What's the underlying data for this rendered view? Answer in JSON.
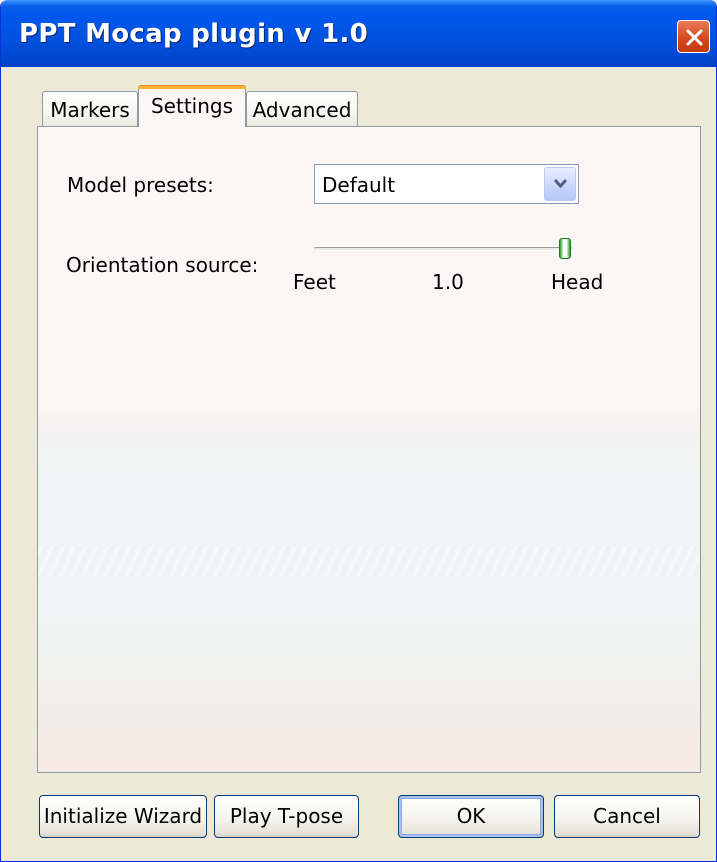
{
  "window": {
    "title": "PPT Mocap plugin v 1.0"
  },
  "tabs": [
    {
      "label": "Markers",
      "active": false
    },
    {
      "label": "Settings",
      "active": true
    },
    {
      "label": "Advanced",
      "active": false
    }
  ],
  "settings": {
    "model_presets": {
      "label": "Model presets:",
      "value": "Default"
    },
    "orientation_source": {
      "label": "Orientation source:",
      "min_label": "Feet",
      "value_label": "1.0",
      "max_label": "Head",
      "value": 1.0
    }
  },
  "buttons": {
    "initialize_wizard": "Initialize Wizard",
    "play_tpose": "Play T-pose",
    "ok": "OK",
    "cancel": "Cancel"
  },
  "colors": {
    "titlebar": "#0054e3",
    "close_button": "#d6461f",
    "active_tab_accent": "#f8b438",
    "slider_thumb": "#21a121"
  }
}
